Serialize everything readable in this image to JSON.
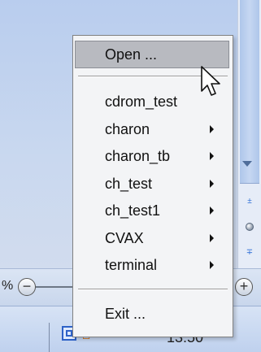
{
  "zoombar": {
    "zoom_text": "%",
    "zoom_minus_symbol": "−",
    "zoom_plus_symbol": "+"
  },
  "menu": {
    "items": [
      {
        "label": "Open ...",
        "highlighted": true
      },
      {
        "label": "cdrom_test",
        "submenu": false
      },
      {
        "label": "charon",
        "submenu": true
      },
      {
        "label": "charon_tb",
        "submenu": true
      },
      {
        "label": "ch_test",
        "submenu": true
      },
      {
        "label": "ch_test1",
        "submenu": true
      },
      {
        "label": "CVAX",
        "submenu": true
      },
      {
        "label": "terminal",
        "submenu": true
      },
      {
        "label": "Exit ...",
        "submenu": false
      }
    ]
  },
  "scrollbar": {
    "prev_symbol": "±",
    "next_symbol": "∓"
  },
  "taskbar": {
    "clock": "13:50",
    "tray_icons": [
      "app-tray-icon",
      "home-tray-icon"
    ]
  },
  "colors": {
    "menu_highlight": "#b8bac0",
    "desktop_top": "#b9cdee"
  }
}
